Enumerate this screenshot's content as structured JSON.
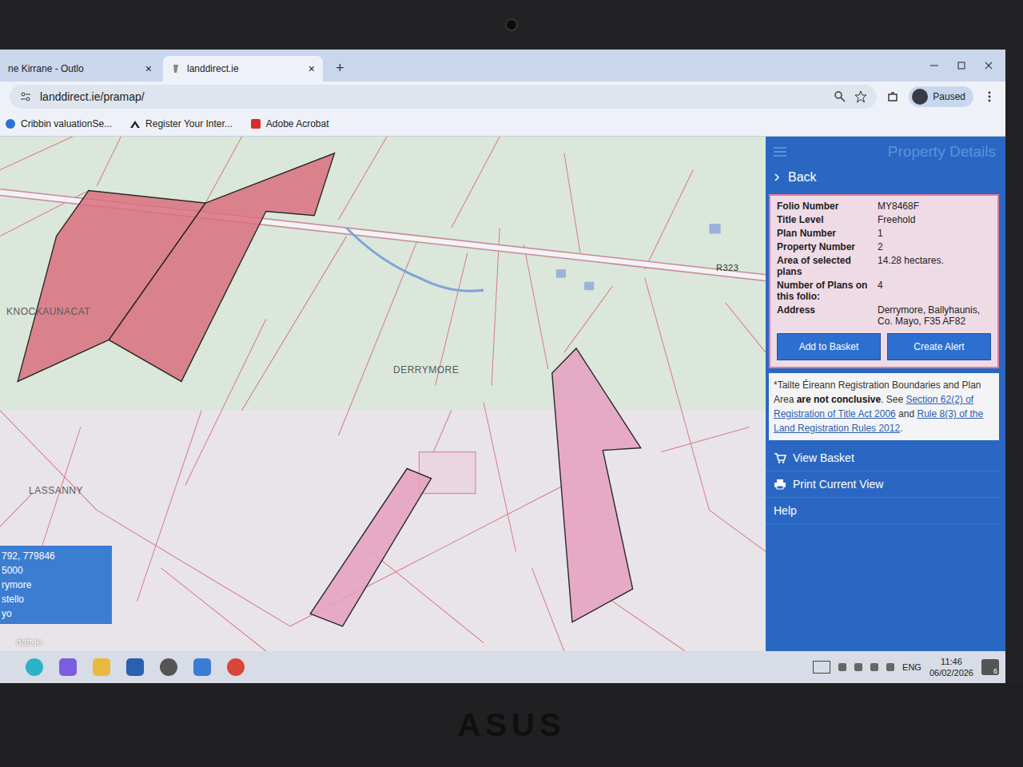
{
  "browser": {
    "tabs": [
      {
        "label": "ne Kirrane - Outlo",
        "close": "×",
        "selected": false
      },
      {
        "label": "landdirect.ie",
        "close": "×",
        "selected": true
      }
    ],
    "new_tab": "+",
    "address": "landdirect.ie/pramap/",
    "bookmarks": [
      "Cribbin valuationSe...",
      "Register Your Inter...",
      "Adobe Acrobat"
    ],
    "profile": "Paused"
  },
  "map": {
    "labels": [
      {
        "text": "KNOCKAUNACAT",
        "kind": "townland"
      },
      {
        "text": "DERRYMORE",
        "kind": "townland"
      },
      {
        "text": "LASSANNY",
        "kind": "townland"
      },
      {
        "text": "R323",
        "kind": "road"
      }
    ],
    "parcels": [
      {
        "selected": true,
        "color": "#d9707e"
      },
      {
        "selected": true,
        "color": "#d9707e"
      },
      {
        "selected": true,
        "color": "#e6a0bf"
      },
      {
        "selected": true,
        "color": "#e6a0bf"
      }
    ],
    "info_box": [
      "792, 779846",
      "5000",
      "rymore",
      "stello",
      "yo"
    ]
  },
  "panel": {
    "title": "Property Details",
    "back": "Back",
    "fields": [
      {
        "label": "Folio Number",
        "value": "MY8468F"
      },
      {
        "label": "Title Level",
        "value": "Freehold"
      },
      {
        "label": "Plan Number",
        "value": "1"
      },
      {
        "label": "Property Number",
        "value": "2"
      },
      {
        "label": "Area of selected plans",
        "value": "14.28 hectares."
      },
      {
        "label": "Number of Plans on this folio:",
        "value": "4"
      },
      {
        "label": "Address",
        "value": "Derrymore, Ballyhaunis, Co. Mayo, F35 AF82"
      }
    ],
    "buttons": [
      "Add to Basket",
      "Create Alert"
    ],
    "disclaimer": [
      {
        "text": "*Tailte Éireann Registration Boundaries and Plan Area ",
        "kind": "plain"
      },
      {
        "text": "are not conclusive",
        "kind": "bold"
      },
      {
        "text": ". See ",
        "kind": "plain"
      },
      {
        "text": "Section 62(2) of Registration of Title Act 2006",
        "kind": "link"
      },
      {
        "text": " and ",
        "kind": "plain"
      },
      {
        "text": "Rule 8(3) of the Land Registration Rules 2012",
        "kind": "link"
      },
      {
        "text": ".",
        "kind": "plain"
      }
    ],
    "menu": [
      {
        "label": "View Basket",
        "kind": "cart"
      },
      {
        "label": "Print Current View",
        "kind": "print"
      },
      {
        "label": "Help",
        "kind": "plain"
      }
    ]
  },
  "taskbar": {
    "language": "ENG",
    "time": "11:46",
    "date": "06/02/2026",
    "notification_count": "6"
  },
  "laptop": {
    "brand": "ASUS"
  },
  "watermark": "daft.ie"
}
